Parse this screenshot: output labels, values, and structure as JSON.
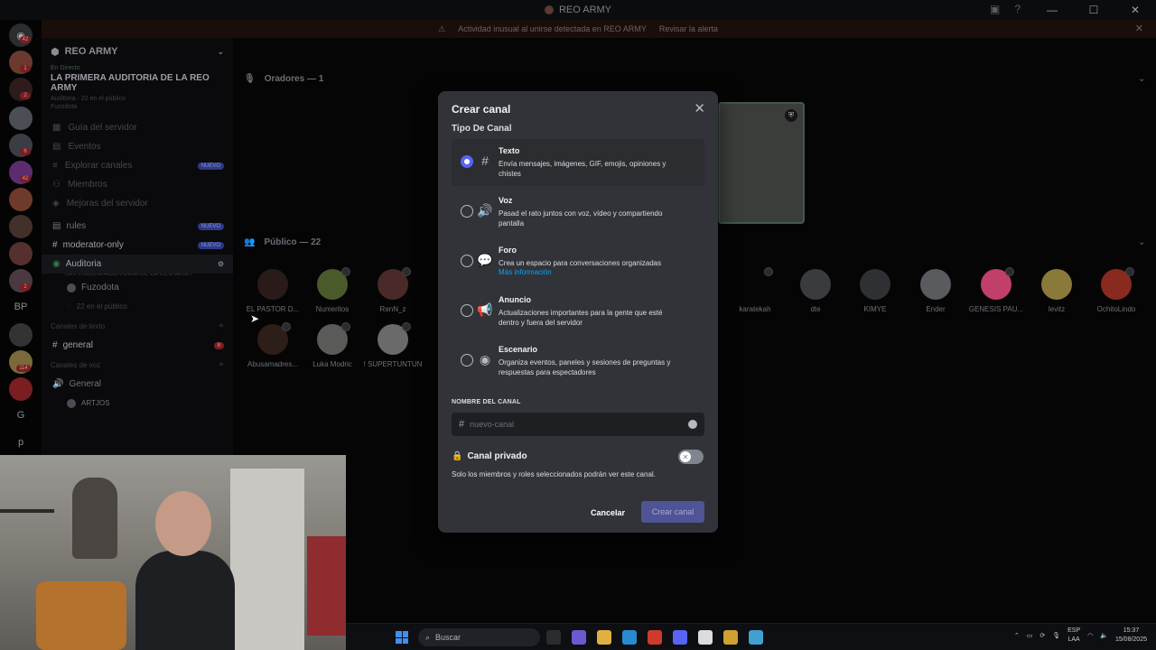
{
  "window": {
    "title": "REO ARMY",
    "controls": [
      "—",
      "☐",
      "✕"
    ]
  },
  "alert": {
    "message": "Actividad inusual al unirse detectada en REO ARMY",
    "action": "Revisar la alerta"
  },
  "guilds": {
    "badges": [
      "42",
      "1",
      "2",
      "6",
      "42",
      "2",
      "114"
    ],
    "text_items": [
      "BP",
      "G",
      "p"
    ]
  },
  "sidebar": {
    "server_name": "REO ARMY",
    "event": {
      "status": "En Directo",
      "title": "LA PRIMERA AUDITORIA DE LA REO ARMY",
      "meta": "Auditoria · 22 en el público",
      "host": "Fuzodota"
    },
    "nav": [
      {
        "label": "Guía del servidor"
      },
      {
        "label": "Eventos"
      },
      {
        "label": "Explorar canales",
        "badge": "NUEVO"
      },
      {
        "label": "Miembros"
      },
      {
        "label": "Mejoras del servidor"
      }
    ],
    "channels": [
      {
        "label": "rules",
        "badge": "NUEVO"
      },
      {
        "label": "moderator-only",
        "badge": "NUEVO"
      }
    ],
    "stage_channel": {
      "label": "Auditoria",
      "topic": "LA PRIMERA AUDITORIA DE LA REO ARMY",
      "speaker": "Fuzodota",
      "audience": "22 en el público"
    },
    "text_category": "Canales de texto",
    "general_text": {
      "label": "general",
      "badge": "8"
    },
    "voice_category": "Canales de voz",
    "voice_general": "General",
    "voice_user": "ARTJOS"
  },
  "stage": {
    "speakers_header": "Oradores — 1",
    "public_header": "Público — 22",
    "members": [
      "EL PASTOR D...",
      "Numeritos",
      "RenN_z",
      "karatekah",
      "dte",
      "KIMYE",
      "Ender",
      "GENESIS PAU...",
      "levitz",
      "OchitoLindo",
      "Abusamadres...",
      "Luka Modric",
      "! SUPERTUNTUN"
    ]
  },
  "modal": {
    "title": "Crear canal",
    "close": "✕",
    "section": "Tipo De Canal",
    "options": [
      {
        "name": "Texto",
        "desc": "Envía mensajes, imágenes, GIF, emojis, opiniones y chistes",
        "icon": "hashtag-icon",
        "glyph": "#",
        "selected": true
      },
      {
        "name": "Voz",
        "desc": "Pasad el rato juntos con voz, vídeo y compartiendo pantalla",
        "icon": "speaker-icon",
        "glyph": "🔊",
        "selected": false
      },
      {
        "name": "Foro",
        "desc": "Crea un espacio para conversaciones organizadas",
        "link": "Más información",
        "icon": "forum-icon",
        "glyph": "💬",
        "selected": false
      },
      {
        "name": "Anuncio",
        "desc": "Actualizaciones importantes para la gente que esté dentro y fuera del servidor",
        "icon": "megaphone-icon",
        "glyph": "📢",
        "selected": false
      },
      {
        "name": "Escenario",
        "desc": "Organiza eventos, paneles y sesiones de preguntas y respuestas para espectadores",
        "icon": "stage-icon",
        "glyph": "◉",
        "selected": false
      }
    ],
    "name_label": "NOMBRE DEL CANAL",
    "name_placeholder": "nuevo-canal",
    "name_prefix": "#",
    "private_label": "Canal privado",
    "private_desc": "Solo los miembros y roles seleccionados podrán ver este canal.",
    "private_enabled": false,
    "cancel_label": "Cancelar",
    "create_label": "Crear canal"
  },
  "taskbar": {
    "search_placeholder": "Buscar",
    "lang_top": "ESP",
    "lang_bottom": "LAA",
    "time": "15:37",
    "date": "15/08/2025"
  },
  "colors": {
    "accent": "#5865f2",
    "modal_bg": "#313338",
    "input_bg": "#1e1f22",
    "link": "#00a8fc"
  }
}
